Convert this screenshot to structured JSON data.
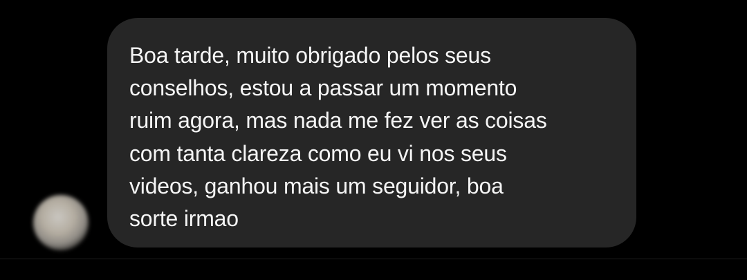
{
  "conversation": {
    "message": {
      "text": "Boa tarde, muito obrigado pelos seus\nconselhos, estou a passar um momento\nruim agora, mas nada me fez ver as coisas\ncom tanta clareza como eu vi nos seus\nvideos, ganhou mais um seguidor, boa\nsorte irmao"
    }
  },
  "colors": {
    "background": "#000000",
    "bubble": "#262626",
    "text": "#f5f5f5"
  }
}
